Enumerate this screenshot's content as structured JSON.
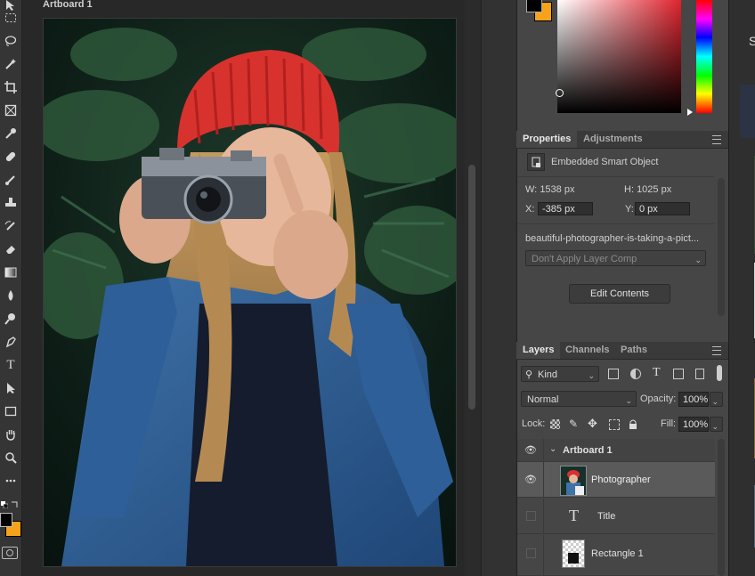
{
  "colors": {
    "foreground": "#000000",
    "background": "#f7a21b",
    "panel": "#464646"
  },
  "canvas": {
    "artboard_label": "Artboard 1"
  },
  "toolbar": {
    "tools": [
      "move-icon",
      "marquee-icon",
      "lasso-icon",
      "magic-wand-icon",
      "crop-icon",
      "frame-icon",
      "eyedropper-icon",
      "healing-brush-icon",
      "brush-icon",
      "stamp-icon",
      "history-brush-icon",
      "eraser-icon",
      "gradient-icon",
      "blur-icon",
      "dodge-icon",
      "pen-icon",
      "type-icon",
      "path-select-icon",
      "rectangle-icon",
      "hand-icon",
      "zoom-icon",
      "more-icon"
    ],
    "type_glyph": "T"
  },
  "properties": {
    "tabs": [
      "Properties",
      "Adjustments"
    ],
    "object_type": "Embedded Smart Object",
    "w_label": "W:",
    "w_value": "1538 px",
    "h_label": "H:",
    "h_value": "1025 px",
    "x_label": "X:",
    "x_value": "-385 px",
    "y_label": "Y:",
    "y_value": "0 px",
    "filename": "beautiful-photographer-is-taking-a-pict...",
    "layer_comp": "Don't Apply Layer Comp",
    "edit_button": "Edit Contents"
  },
  "layers": {
    "tabs": [
      "Layers",
      "Channels",
      "Paths"
    ],
    "filter_kind": "Kind",
    "blend_mode": "Normal",
    "opacity_label": "Opacity:",
    "opacity_value": "100%",
    "lock_label": "Lock:",
    "fill_label": "Fill:",
    "fill_value": "100%",
    "artboard_name": "Artboard 1",
    "items": [
      {
        "name": "Photographer",
        "visible": true
      },
      {
        "name": "Title",
        "visible": false,
        "glyph": "T"
      },
      {
        "name": "Rectangle 1",
        "visible": false
      }
    ]
  },
  "right_strip": {
    "letter": "S"
  }
}
